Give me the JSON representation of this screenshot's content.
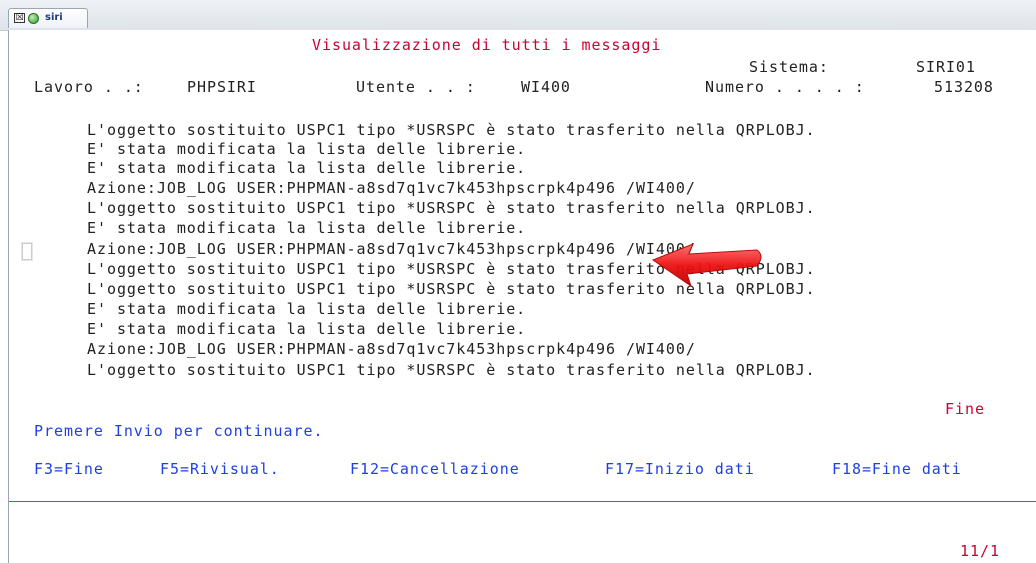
{
  "tab": {
    "label": "siri",
    "close_glyph": "☒",
    "status_icon": "green-circle-icon"
  },
  "header": {
    "title": "Visualizzazione di tutti i messaggi",
    "sistema_label": "Sistema:",
    "sistema_value": "SIRI01",
    "lavoro_label": "Lavoro . .:",
    "lavoro_value": "PHPSIRI",
    "utente_label": "Utente . . :",
    "utente_value": "WI400",
    "numero_label": "Numero . . . . :",
    "numero_value": "513208"
  },
  "messages": [
    "L'oggetto sostituito USPC1 tipo *USRSPC è stato trasferito nella QRPLOBJ.",
    "E' stata modificata la lista delle librerie.",
    "E' stata modificata la lista delle librerie.",
    "Azione:JOB_LOG USER:PHPMAN-a8sd7q1vc7k453hpscrpk4p496 /WI400/",
    "L'oggetto sostituito USPC1 tipo *USRSPC è stato trasferito nella QRPLOBJ.",
    "E' stata modificata la lista delle librerie.",
    "Azione:JOB_LOG USER:PHPMAN-a8sd7q1vc7k453hpscrpk4p496 /WI400/",
    "L'oggetto sostituito USPC1 tipo *USRSPC è stato trasferito nella QRPLOBJ.",
    "L'oggetto sostituito USPC1 tipo *USRSPC è stato trasferito nella QRPLOBJ.",
    "E' stata modificata la lista delle librerie.",
    "E' stata modificata la lista delle librerie.",
    "Azione:JOB_LOG USER:PHPMAN-a8sd7q1vc7k453hpscrpk4p496 /WI400/",
    "L'oggetto sostituito USPC1 tipo *USRSPC è stato trasferito nella QRPLOBJ."
  ],
  "footer": {
    "more_indicator": "Fine",
    "prompt": "Premere Invio per continuare.",
    "function_keys": [
      "F3=Fine",
      "F5=Rivisual.",
      "F12=Cancellazione",
      "F17=Inizio dati",
      "F18=Fine dati"
    ],
    "cursor_position": "11/1"
  },
  "colors": {
    "title": "#cc0033",
    "prompt": "#1f3fe6",
    "text": "#222222",
    "annotation_arrow": "#ee1111"
  }
}
